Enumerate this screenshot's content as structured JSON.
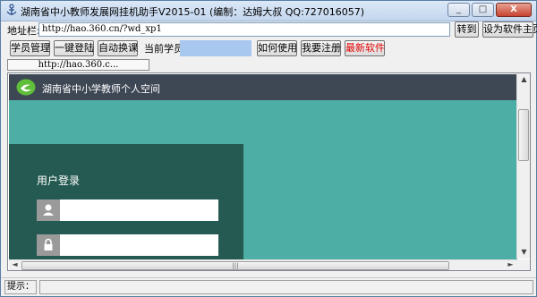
{
  "window": {
    "title": "湖南省中小教师发展网挂机助手V2015-01 (编制：达姆大叔 QQ:727016057)",
    "minimize_glyph": "_",
    "maximize_glyph": "□",
    "close_glyph": "X"
  },
  "address": {
    "label": "地址栏:",
    "value": "http://hao.360.cn/?wd_xp1",
    "go_label": "转到",
    "set_home_label": "设为软件主页"
  },
  "toolbar": {
    "manage_label": "学员管理",
    "login_label": "一键登陆",
    "switch_label": "自动换课",
    "current_label": "当前学员:",
    "current_value": "",
    "howto_label": "如何使用",
    "register_label": "我要注册",
    "latest_label": "最新软件",
    "latest_color": "#e00000"
  },
  "tabs": [
    {
      "label": "http://hao.360.c..."
    }
  ],
  "webpage": {
    "site_title": "湖南省中小学教师个人空间",
    "login_title": "用户登录",
    "username_icon": "user-icon",
    "password_icon": "lock-icon",
    "header_color": "#3e4754",
    "bg_color": "#4daea6",
    "panel_color": "#245a52"
  },
  "status": {
    "label": "提示："
  }
}
